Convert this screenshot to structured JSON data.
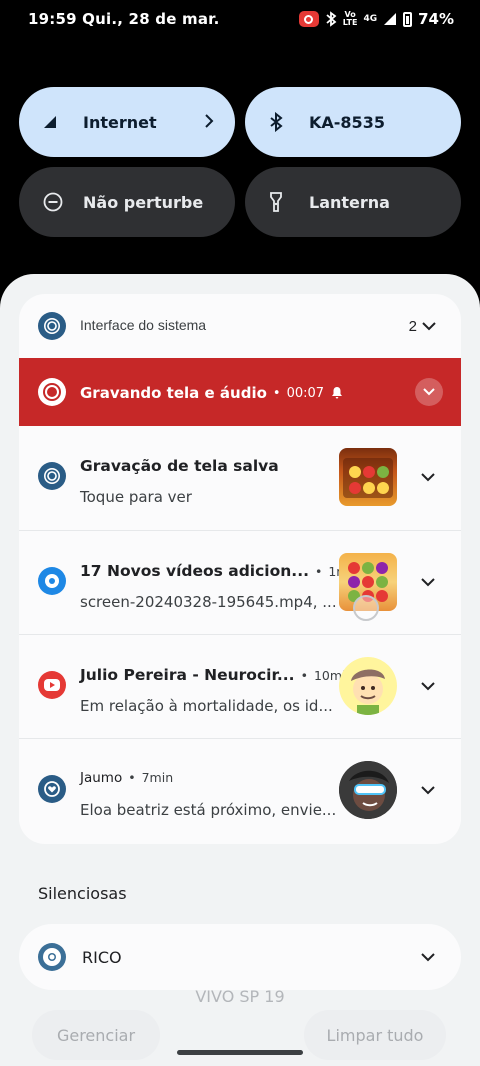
{
  "status_bar": {
    "time_date": "19:59 Qui., 28 de mar.",
    "volte_top": "Vo",
    "volte_bottom": "LTE",
    "network": "4G",
    "battery": "74%",
    "battery_level": 0.74
  },
  "quick_settings": [
    {
      "label": "Internet",
      "state": "on"
    },
    {
      "label": "KA-8535",
      "state": "on"
    },
    {
      "label": "Não perturbe",
      "state": "off"
    },
    {
      "label": "Lanterna",
      "state": "off"
    }
  ],
  "group": {
    "title": "Interface do sistema",
    "count": "2",
    "recording": {
      "title": "Gravando tela e áudio",
      "time": "00:07"
    }
  },
  "notifications": [
    {
      "title": "Gravação de tela salva",
      "time": "",
      "text": "Toque para ver"
    },
    {
      "title": "17 Novos vídeos adicion...",
      "time": "1min",
      "text": "screen-20240328-195645.mp4, ..."
    },
    {
      "title": "Julio Pereira - Neurocir...",
      "time": "10min",
      "text": "Em relação à mortalidade, os id..."
    },
    {
      "title": "Jaumo",
      "time": "7min",
      "text": "Eloa beatriz está próximo, envie..."
    }
  ],
  "silent_section": {
    "label": "Silenciosas",
    "items": [
      {
        "name": "RICO"
      }
    ]
  },
  "footer": {
    "carrier": "VIVO SP 19",
    "manage": "Gerenciar",
    "clear_all": "Limpar tudo"
  },
  "colors": {
    "tile_on": "#cfe4fb",
    "tile_off": "#2f3033",
    "recording_bar": "#c62828",
    "shade_bg": "#f1f3f4"
  }
}
